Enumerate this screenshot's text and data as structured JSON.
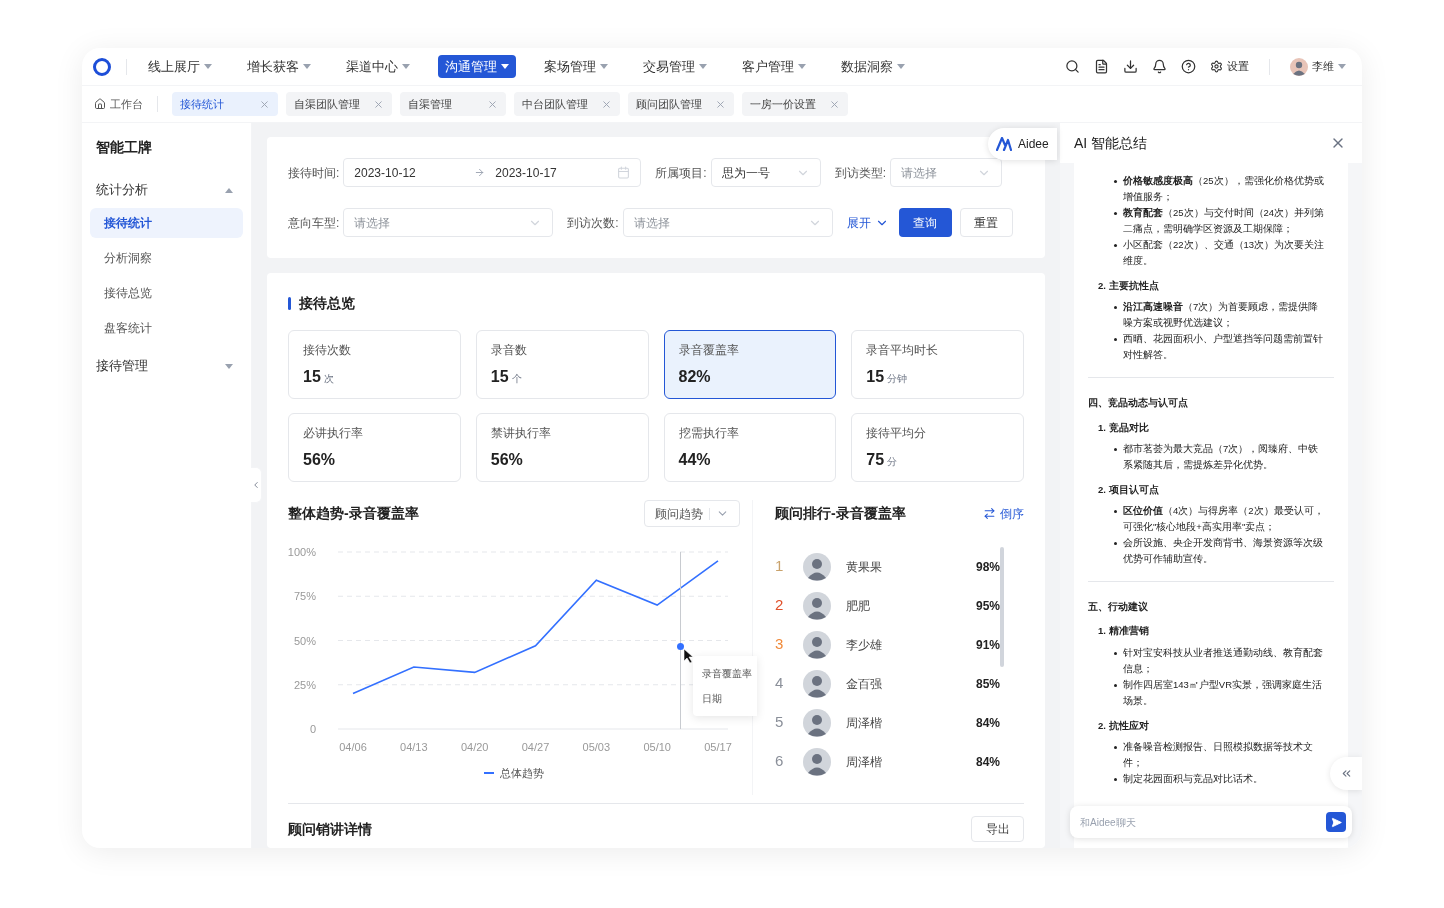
{
  "nav": {
    "items": [
      {
        "label": "线上展厅",
        "selected": false
      },
      {
        "label": "增长获客",
        "selected": false
      },
      {
        "label": "渠道中心",
        "selected": false
      },
      {
        "label": "沟通管理",
        "selected": true
      },
      {
        "label": "案场管理",
        "selected": false
      },
      {
        "label": "交易管理",
        "selected": false
      },
      {
        "label": "客户管理",
        "selected": false
      },
      {
        "label": "数据洞察",
        "selected": false
      }
    ],
    "settings": "设置",
    "user": "李维"
  },
  "tabs": {
    "home": "工作台",
    "items": [
      {
        "label": "接待统计",
        "selected": true
      },
      {
        "label": "自渠团队管理",
        "selected": false
      },
      {
        "label": "自渠管理",
        "selected": false
      },
      {
        "label": "中台团队管理",
        "selected": false
      },
      {
        "label": "顾问团队管理",
        "selected": false
      },
      {
        "label": "一房一价设置",
        "selected": false
      }
    ]
  },
  "sidebar": {
    "title": "智能工牌",
    "groups": [
      {
        "label": "统计分析",
        "expanded": true,
        "children": [
          {
            "label": "接待统计",
            "selected": true
          },
          {
            "label": "分析洞察",
            "selected": false
          },
          {
            "label": "接待总览",
            "selected": false
          },
          {
            "label": "盘客统计",
            "selected": false
          }
        ]
      },
      {
        "label": "接待管理",
        "expanded": false
      }
    ]
  },
  "filters": {
    "rows": [
      [
        {
          "kind": "date_range",
          "label": "接待时间:",
          "start": "2023-10-12",
          "end": "2023-10-17"
        },
        {
          "kind": "select",
          "label": "所属项目:",
          "value": "思为一号"
        },
        {
          "kind": "select",
          "label": "到访类型:",
          "placeholder": "请选择"
        }
      ],
      [
        {
          "kind": "select",
          "label": "意向车型:",
          "placeholder": "请选择"
        },
        {
          "kind": "select",
          "label": "到访次数:",
          "placeholder": "请选择"
        }
      ]
    ],
    "expand": "展开",
    "query": "查询",
    "reset": "重置"
  },
  "overview": {
    "title": "接待总览",
    "stats": [
      {
        "label": "接待次数",
        "value": "15",
        "unit": "次",
        "selected": false
      },
      {
        "label": "录音数",
        "value": "15",
        "unit": "个",
        "selected": false
      },
      {
        "label": "录音覆盖率",
        "value": "82%",
        "selected": true
      },
      {
        "label": "录音平均时长",
        "value": "15",
        "unit": "分钟",
        "selected": false
      },
      {
        "label": "必讲执行率",
        "value": "56%",
        "selected": false
      },
      {
        "label": "禁讲执行率",
        "value": "56%",
        "selected": false
      },
      {
        "label": "挖需执行率",
        "value": "44%",
        "selected": false
      },
      {
        "label": "接待平均分",
        "value": "75",
        "unit": "分",
        "selected": false
      }
    ]
  },
  "trend": {
    "title": "整体趋势-录音覆盖率",
    "dropdown": "顾问趋势",
    "chart_data": {
      "type": "line",
      "categories": [
        "04/06",
        "04/13",
        "04/20",
        "04/27",
        "05/03",
        "05/10",
        "05/17"
      ],
      "series": [
        {
          "name": "总体趋势",
          "color": "#3370ff",
          "values": [
            20,
            35,
            32,
            47,
            84,
            70,
            95
          ]
        }
      ],
      "ylim": [
        0,
        100
      ],
      "grid": true,
      "yticks": [
        {
          "value": 0,
          "label": "0"
        },
        {
          "value": 25,
          "label": "25%"
        },
        {
          "value": 50,
          "label": "50%"
        },
        {
          "value": 75,
          "label": "75%"
        },
        {
          "value": 100,
          "label": "100%"
        }
      ]
    },
    "tooltip": {
      "label": "录音覆盖率",
      "date_label": "日期"
    }
  },
  "ranking": {
    "title": "顾问排行-录音覆盖率",
    "sort": "倒序",
    "rows": [
      {
        "rank": "1",
        "color": "#c9a26b",
        "name": "黄果果",
        "value": "98%"
      },
      {
        "rank": "2",
        "color": "#e0502a",
        "name": "肥肥",
        "value": "95%"
      },
      {
        "rank": "3",
        "color": "#f08a3a",
        "name": "李少雄",
        "value": "91%"
      },
      {
        "rank": "4",
        "color": "#8a8f99",
        "name": "金百强",
        "value": "85%"
      },
      {
        "rank": "5",
        "color": "#8a8f99",
        "name": "周泽楷",
        "value": "84%"
      },
      {
        "rank": "6",
        "color": "#8a8f99",
        "name": "周泽楷",
        "value": "84%"
      }
    ]
  },
  "details": {
    "title": "顾问销讲详情",
    "export": "导出"
  },
  "ai": {
    "badge": "Aidee",
    "title": "AI 智能总结",
    "blocks": [
      {
        "kind": "bullet",
        "text": "**价格敏感度极高**（25次），需强化价格优势或增值服务；"
      },
      {
        "kind": "bullet",
        "text": "**教育配套**（25次）与交付时间（24次）并列第二痛点，需明确学区资源及工期保障；"
      },
      {
        "kind": "bullet",
        "text": "小区配套（22次）、交通（13次）为次要关注维度。"
      },
      {
        "kind": "sub",
        "text": "2. 主要抗性点"
      },
      {
        "kind": "bullet",
        "text": "**沿江高速噪音**（7次）为首要顾虑，需提供降噪方案或视野优选建议；"
      },
      {
        "kind": "bullet",
        "text": "西晒、花园面积小、户型遮挡等问题需前置针对性解答。"
      },
      {
        "kind": "divider"
      },
      {
        "kind": "heading",
        "text": "四、竞品动态与认可点"
      },
      {
        "kind": "sub",
        "text": "1. 竞品对比"
      },
      {
        "kind": "bullet",
        "text": "都市茗荟为最大竞品（7次），阅臻府、中铁系紧随其后，需提炼差异化优势。"
      },
      {
        "kind": "sub",
        "text": "2. 项目认可点"
      },
      {
        "kind": "bullet",
        "text": "**区位价值**（4次）与得房率（2次）最受认可，可强化\"核心地段+高实用率\"卖点；"
      },
      {
        "kind": "bullet",
        "text": "会所设施、央企开发商背书、海景资源等次级优势可作辅助宣传。"
      },
      {
        "kind": "divider"
      },
      {
        "kind": "heading",
        "text": "五、行动建议"
      },
      {
        "kind": "sub",
        "text": "1. 精准营销"
      },
      {
        "kind": "bullet",
        "text": "针对宝安科技从业者推送通勤动线、教育配套信息；"
      },
      {
        "kind": "bullet",
        "text": "制作四居室143㎡户型VR实景，强调家庭生活场景。"
      },
      {
        "kind": "sub",
        "text": "2. 抗性应对"
      },
      {
        "kind": "bullet",
        "text": "准备噪音检测报告、日照模拟数据等技术文件；"
      },
      {
        "kind": "bullet",
        "text": "制定花园面积与竞品对比话术。"
      }
    ],
    "input_placeholder": "和Aidee聊天"
  }
}
